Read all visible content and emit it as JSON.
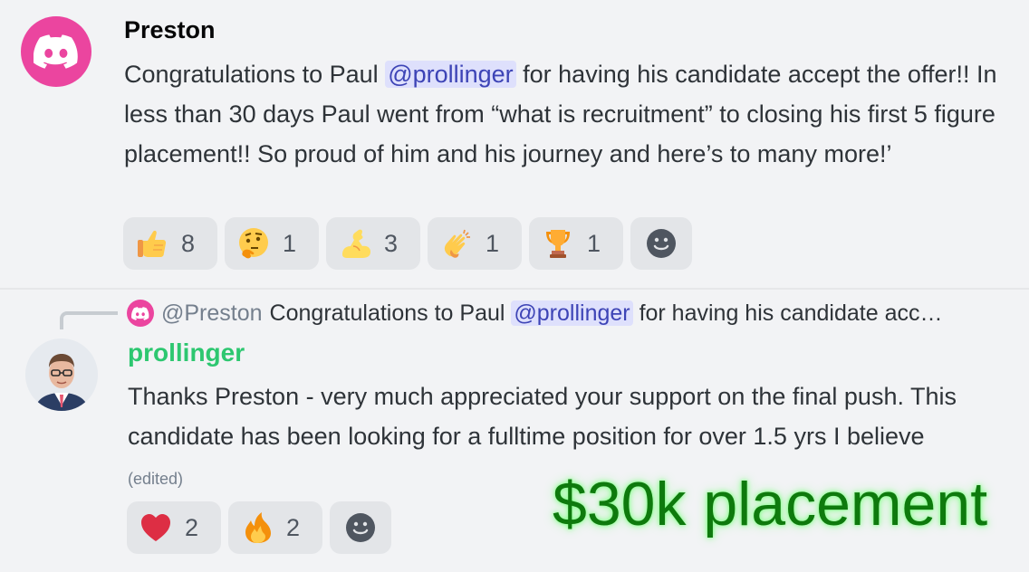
{
  "message1": {
    "author": "Preston",
    "text_before": "Congratulations to Paul ",
    "mention": "@prollinger",
    "text_after": " for having his candidate accept the offer!! In less than 30 days Paul went from “what is recruitment” to closing his first 5 figure placement!! So proud of him and his journey and here’s to many more!’",
    "reactions": [
      {
        "emoji": "thumbs-up",
        "count": "8"
      },
      {
        "emoji": "thinking-face",
        "count": "1"
      },
      {
        "emoji": "flexed-biceps",
        "count": "3"
      },
      {
        "emoji": "clapping-hands",
        "count": "1"
      },
      {
        "emoji": "trophy",
        "count": "1"
      }
    ]
  },
  "reply": {
    "ref_author": "@Preston",
    "ref_text_before": "Congratulations to Paul",
    "ref_mention": "@prollinger",
    "ref_text_after": "for having his candidate acc…",
    "author": "prollinger",
    "text": "Thanks Preston - very much appreciated your support on the final push. This candidate has been looking for a fulltime position for over 1.5 yrs I believe",
    "edited_label": "(edited)",
    "reactions": [
      {
        "emoji": "red-heart",
        "count": "2"
      },
      {
        "emoji": "fire",
        "count": "2"
      }
    ]
  },
  "overlay_text": "$30k placement",
  "colors": {
    "discord_pink": "#eb459f",
    "mention_bg": "#dee0fc",
    "mention_fg": "#3d44b6",
    "username_green": "#2dc770",
    "overlay_green": "#0e7a0d"
  }
}
